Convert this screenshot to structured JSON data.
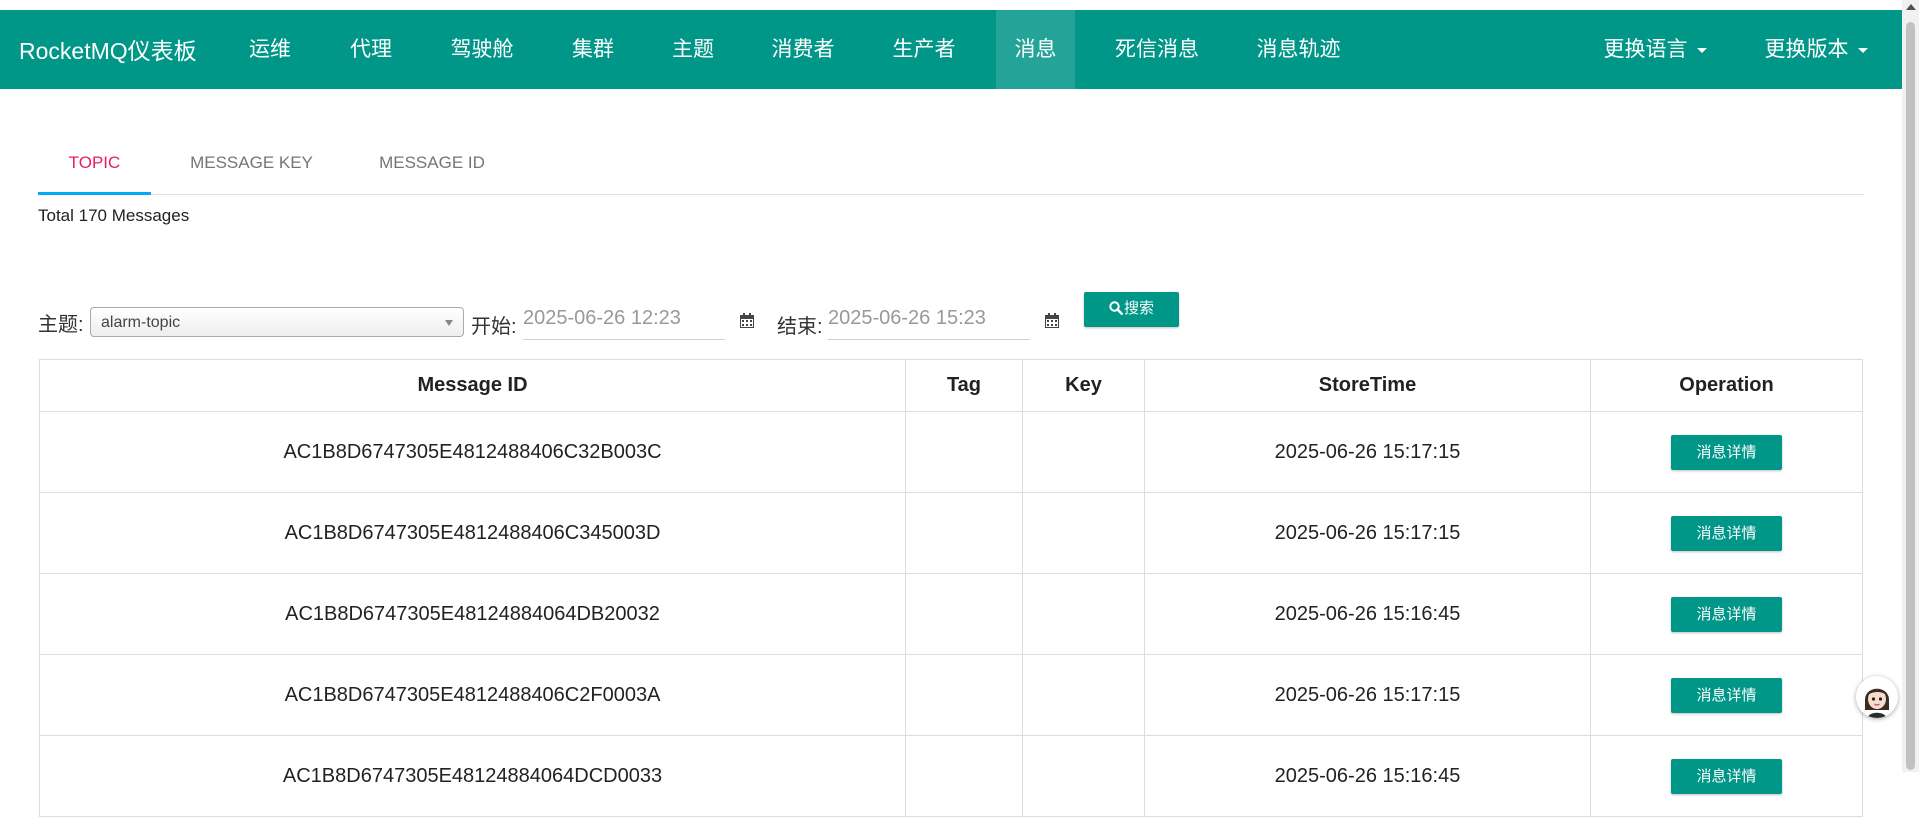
{
  "navbar": {
    "brand": "RocketMQ仪表板",
    "items": [
      {
        "label": "运维"
      },
      {
        "label": "代理"
      },
      {
        "label": "驾驶舱"
      },
      {
        "label": "集群"
      },
      {
        "label": "主题"
      },
      {
        "label": "消费者"
      },
      {
        "label": "生产者"
      },
      {
        "label": "消息",
        "active": true
      },
      {
        "label": "死信消息"
      },
      {
        "label": "消息轨迹"
      }
    ],
    "language_label": "更换语言",
    "version_label": "更换版本"
  },
  "tabs": [
    {
      "label": "TOPIC",
      "active": true
    },
    {
      "label": "MESSAGE KEY"
    },
    {
      "label": "MESSAGE ID"
    }
  ],
  "total_text": "Total 170 Messages",
  "search_form": {
    "topic_label": "主题:",
    "topic_value": "alarm-topic",
    "start_label": "开始:",
    "start_value": "2025-06-26 12:23",
    "end_label": "结束:",
    "end_value": "2025-06-26 15:23",
    "search_label": "搜索"
  },
  "table": {
    "headers": [
      "Message ID",
      "Tag",
      "Key",
      "StoreTime",
      "Operation"
    ],
    "rows": [
      {
        "id": "AC1B8D6747305E4812488406C32B003C",
        "tag": "",
        "key": "",
        "time": "2025-06-26 15:17:15",
        "op": "消息详情"
      },
      {
        "id": "AC1B8D6747305E4812488406C345003D",
        "tag": "",
        "key": "",
        "time": "2025-06-26 15:17:15",
        "op": "消息详情"
      },
      {
        "id": "AC1B8D6747305E48124884064DB20032",
        "tag": "",
        "key": "",
        "time": "2025-06-26 15:16:45",
        "op": "消息详情"
      },
      {
        "id": "AC1B8D6747305E4812488406C2F0003A",
        "tag": "",
        "key": "",
        "time": "2025-06-26 15:17:15",
        "op": "消息详情"
      },
      {
        "id": "AC1B8D6747305E48124884064DCD0033",
        "tag": "",
        "key": "",
        "time": "2025-06-26 15:16:45",
        "op": "消息详情"
      }
    ]
  },
  "colors": {
    "primary": "#009688",
    "tab_active_text": "#e91e63",
    "tab_indicator": "#03a9f4"
  }
}
